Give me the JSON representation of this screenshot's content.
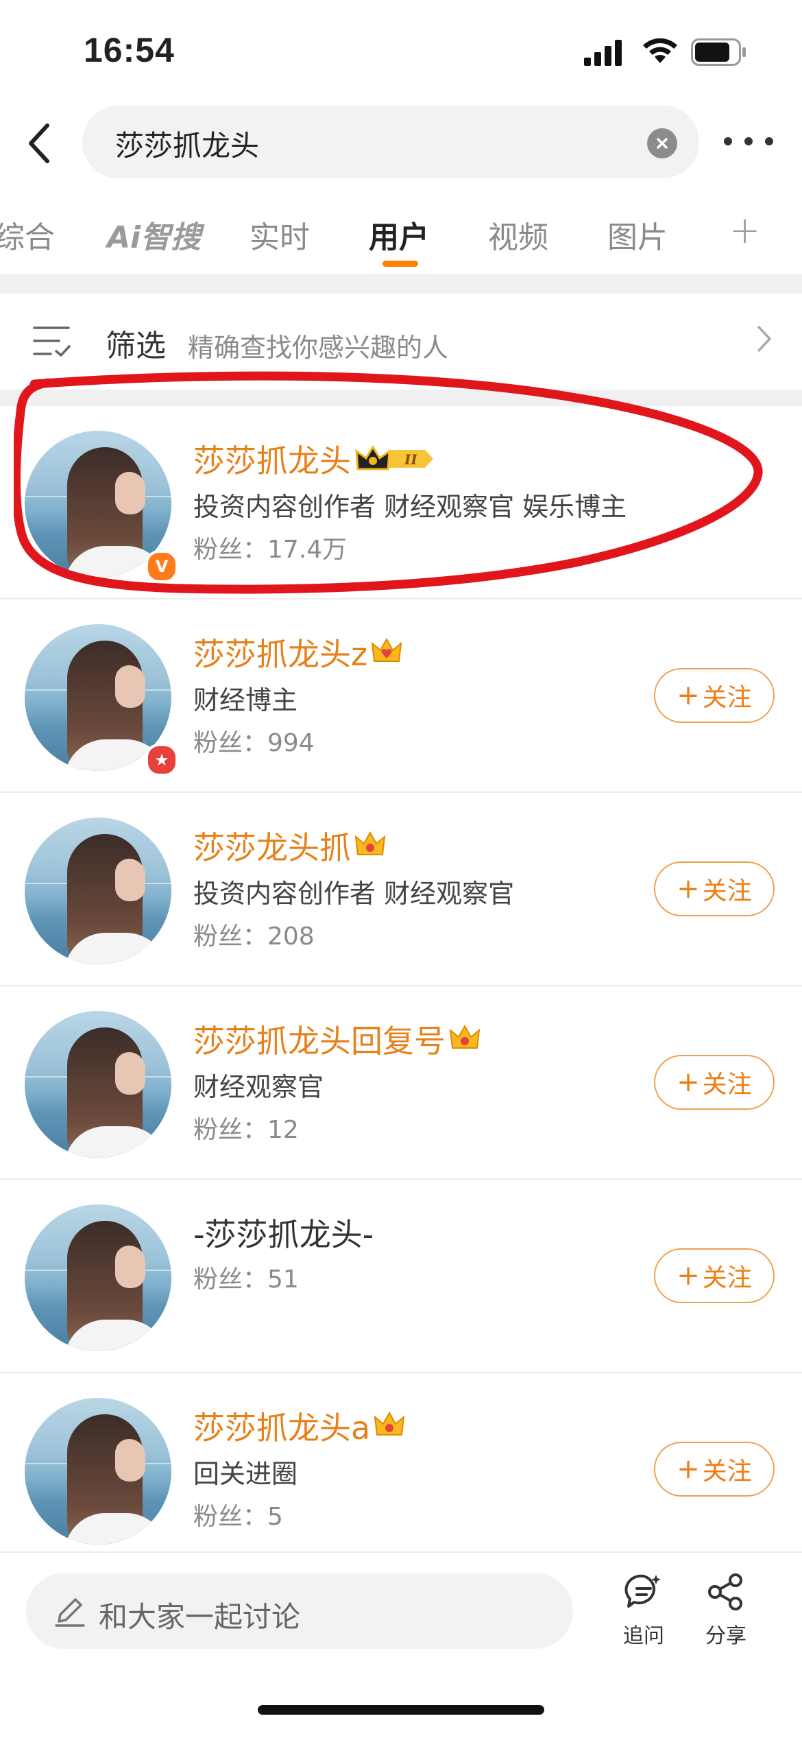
{
  "status_bar": {
    "time": "16:54"
  },
  "search": {
    "query": "莎莎抓龙头"
  },
  "tabs": [
    {
      "label": "综合"
    },
    {
      "label": "Ai智搜"
    },
    {
      "label": "实时"
    },
    {
      "label": "用户",
      "active": true
    },
    {
      "label": "视频"
    },
    {
      "label": "图片"
    },
    {
      "label": "+"
    }
  ],
  "filter": {
    "label": "筛选",
    "hint": "精确查找你感兴趣的人"
  },
  "users": [
    {
      "name": "莎莎抓龙头",
      "desc": "投资内容创作者  财经观察官  娱乐博主",
      "fans": "粉丝：17.4万",
      "badge": "V",
      "highlighted": true
    },
    {
      "name": "莎莎抓龙头z",
      "desc": "财经博主",
      "fans": "粉丝：994",
      "badge": "★",
      "follow": "关注"
    },
    {
      "name": "莎莎龙头抓",
      "desc": "投资内容创作者 财经观察官",
      "fans": "粉丝：208",
      "follow": "关注"
    },
    {
      "name": "莎莎抓龙头回复号",
      "desc": "财经观察官",
      "fans": "粉丝：12",
      "follow": "关注"
    },
    {
      "name": "-莎莎抓龙头-",
      "desc": "",
      "fans": "粉丝：51",
      "follow": "关注"
    },
    {
      "name": "莎莎抓龙头a",
      "desc": "回关进圈",
      "fans": "粉丝：5",
      "follow": "关注"
    }
  ],
  "bottom_bar": {
    "comment_placeholder": "和大家一起讨论",
    "ask_label": "追问",
    "share_label": "分享"
  },
  "colors": {
    "accent": "#ff8200",
    "name_orange": "#e8801a",
    "highlight_red": "#e0161c"
  }
}
